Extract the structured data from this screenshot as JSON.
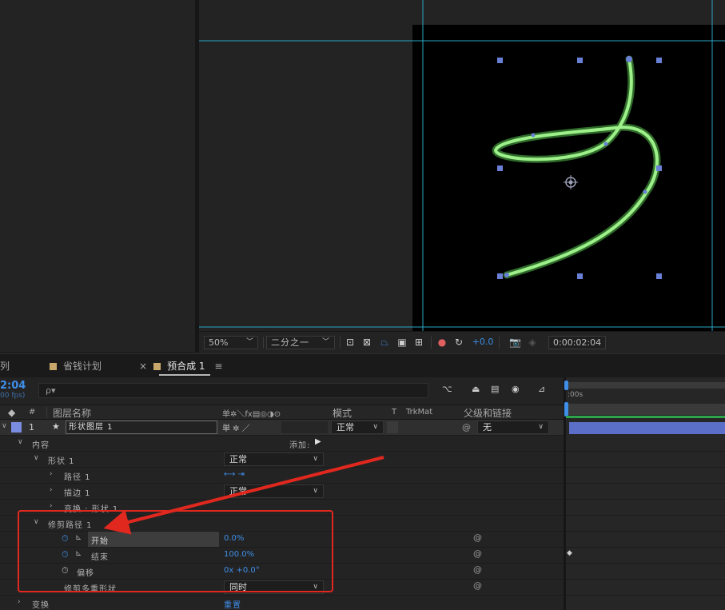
{
  "viewer": {
    "zoom": "50%",
    "resolution": "二分之一",
    "exposure": "+0.0",
    "timecode": "0:00:02:04"
  },
  "tabs": {
    "partial": "列",
    "tab1": "省钱计划",
    "tab2_close": "×",
    "tab2": "预合成 1",
    "menu": "≡",
    "tab1_color": "#c8a86a",
    "tab2_color": "#c8a86a"
  },
  "timeline": {
    "current_time": "2:04",
    "fps": "00 fps)",
    "search_placeholder": "ρ▾",
    "ruler_label": ":00s"
  },
  "columns": {
    "hash": "#",
    "layer_name": "图层名称",
    "switches": "单✲＼fx▤◎◑⊙",
    "mode": "模式",
    "t": "T",
    "trkmat": "TrkMat",
    "parent": "父级和链接"
  },
  "layer": {
    "index": "1",
    "name": "形状图层 1",
    "mode": "正常",
    "parent": "无",
    "label_color": "#7b8de0"
  },
  "tree": {
    "contents": "内容",
    "add": "添加:",
    "shape1": "形状 1",
    "shape1_mode": "正常",
    "path1": "路径 1",
    "stroke1": "描边 1",
    "stroke1_mode": "正常",
    "transform_shape": "变换 : 形状 1",
    "trim_paths": "修剪路径 1",
    "start_label": "开始",
    "start_value": "0.0%",
    "end_label": "结束",
    "end_value": "100.0%",
    "offset_label": "偏移",
    "offset_value": "0x +0.0°",
    "trim_multiple_label": "修剪多重形状",
    "trim_multiple_value": "同时",
    "transform": "变换",
    "reset": "重置"
  },
  "colors": {
    "accent": "#3f8ee8",
    "annotation": "#e0281e",
    "stroke": "#8fe07a",
    "handle": "#6a7fd6"
  }
}
